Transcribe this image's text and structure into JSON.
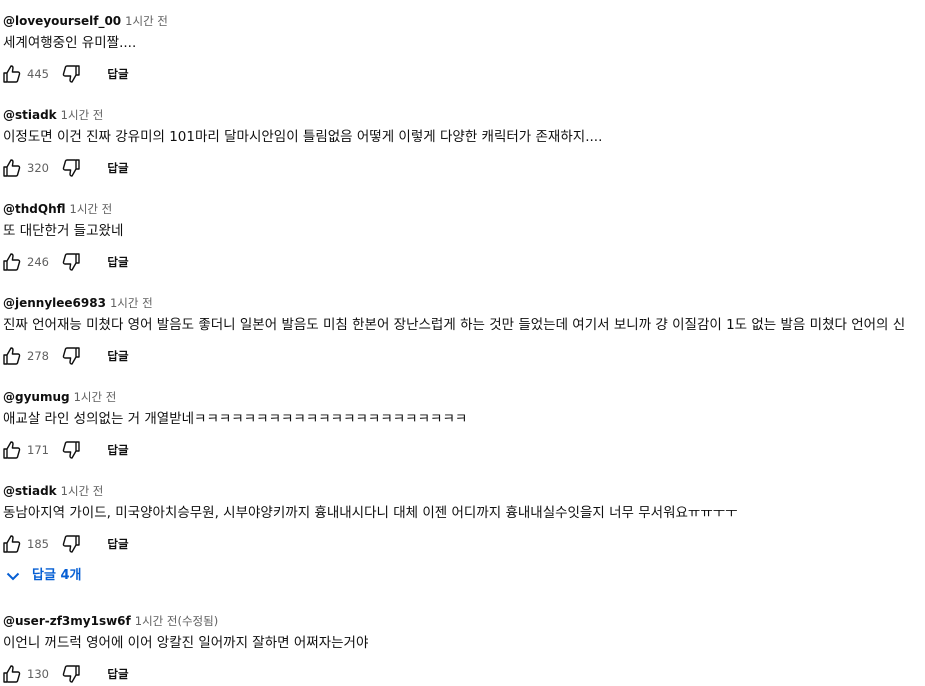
{
  "comments": [
    {
      "author": "@loveyourself_00",
      "time": "1시간 전",
      "text": "세계여행중인 유미짤....",
      "likes": "445",
      "reply_label": "답글"
    },
    {
      "author": "@stiadk",
      "time": "1시간 전",
      "text": "이정도면 이건 진짜 강유미의 101마리 달마시안임이 틀림없음 어떻게 이렇게 다양한 캐릭터가 존재하지....",
      "likes": "320",
      "reply_label": "답글"
    },
    {
      "author": "@thdQhfl",
      "time": "1시간 전",
      "text": "또 대단한거 들고왔네",
      "likes": "246",
      "reply_label": "답글"
    },
    {
      "author": "@jennylee6983",
      "time": "1시간 전",
      "text": "진짜 언어재능 미쳤다 영어 발음도 좋더니 일본어 발음도 미침 한본어 장난스럽게 하는 것만 들었는데 여기서 보니까 걍 이질감이 1도 없는 발음 미쳤다 언어의 신",
      "likes": "278",
      "reply_label": "답글"
    },
    {
      "author": "@gyumug",
      "time": "1시간 전",
      "text": "애교살 라인 성의없는 거 개열받네ㅋㅋㅋㅋㅋㅋㅋㅋㅋㅋㅋㅋㅋㅋㅋㅋㅋㅋㅋㅋㅋㅋ",
      "likes": "171",
      "reply_label": "답글"
    },
    {
      "author": "@stiadk",
      "time": "1시간 전",
      "text": "동남아지역 가이드, 미국양아치승무원, 시부야양키까지 흉내내시다니 대체 이젠 어디까지 흉내내실수잇을지 너무 무서워요ㅠㅠㅜㅜ",
      "likes": "185",
      "reply_label": "답글"
    },
    {
      "author": "@user-zf3my1sw6f",
      "time": "1시간 전(수정됨)",
      "text": "이언니 꺼드럭 영어에 이어 앙칼진 일어까지 잘하면 어쩌자는거야",
      "likes": "130",
      "reply_label": "답글"
    }
  ],
  "replies_toggle": {
    "label": "답글 4개",
    "icon": "chevron-down-icon"
  },
  "colors": {
    "accent": "#065fd4",
    "secondary_text": "#606060",
    "primary_text": "#0f0f0f"
  }
}
